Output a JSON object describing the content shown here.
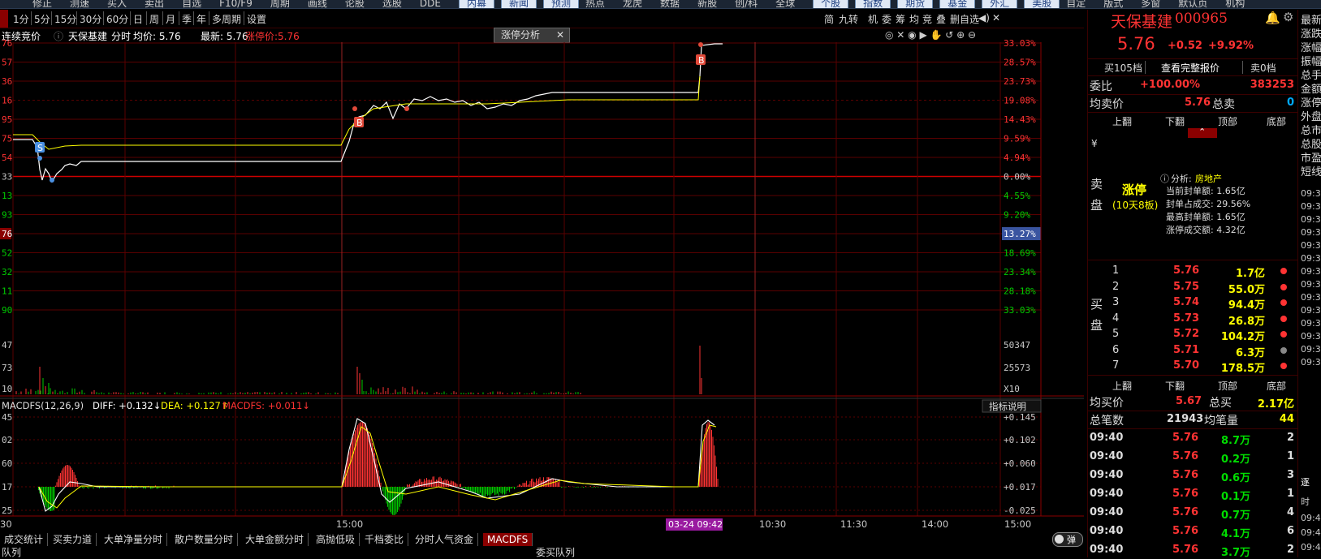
{
  "top_menu": [
    "修正",
    "测速",
    "买入",
    "卖出",
    "自选",
    "F10/F9",
    "周期",
    "画线",
    "论股",
    "选股",
    "DDE",
    "内幕",
    "新闻",
    "预测",
    "热点",
    "龙虎",
    "数据",
    "新股",
    "创/科",
    "全球",
    "个股",
    "指数",
    "期货",
    "基金",
    "外汇",
    "美股",
    "自定",
    "版式",
    "多窗",
    "默认页",
    "机构"
  ],
  "periods": [
    "1分",
    "5分",
    "15分",
    "30分",
    "60分",
    "日",
    "周",
    "月",
    "季",
    "年",
    "多周期",
    "设置"
  ],
  "left_cut_label": "周期",
  "right_toolbar": [
    "简",
    "九转",
    "机",
    "委",
    "筹",
    "均",
    "竞",
    "叠",
    "删自选"
  ],
  "info": {
    "prefix": "连续竞价",
    "name": "天保基建",
    "mode": "分时",
    "avg_label": "均价: 5.76",
    "latest_label": "最新: 5.76",
    "limit_label": "涨停价:5.76",
    "zt_tab": "涨停分析"
  },
  "price_axis_left": [
    "76",
    "57",
    "36",
    "16",
    "95",
    "75",
    "54",
    "33",
    "13",
    "93",
    "76",
    "52",
    "32",
    "11",
    "90"
  ],
  "price_axis_right": [
    "33.03%",
    "28.57%",
    "23.73%",
    "19.08%",
    "14.43%",
    "9.59%",
    "4.94%",
    "0.00%",
    "4.55%",
    "9.20%",
    "13.27%",
    "18.69%",
    "23.34%",
    "28.18%",
    "33.03%"
  ],
  "volume_axis_left": [
    "47",
    "73",
    "10"
  ],
  "volume_axis_right": [
    "50347",
    "25573",
    "X10"
  ],
  "macd": {
    "header": "MACDFS(12,26,9)",
    "diff": "DIFF: +0.132",
    "dea": "DEA: +0.127",
    "macdfs": "MACDFS: +0.011",
    "indicator_btn": "指标说明",
    "left_axis": [
      "45",
      "02",
      "60",
      "17",
      "25"
    ],
    "right_axis": [
      "+0.145",
      "+0.102",
      "+0.060",
      "+0.017",
      "-0.025"
    ]
  },
  "time_axis": {
    "left_cut": "30",
    "labels": [
      "15:00",
      "10:30",
      "11:30",
      "14:00",
      "15:00"
    ],
    "highlight": "03-24 09:42"
  },
  "bottom_tabs": [
    "成交统计",
    "买卖力道",
    "大单净量分时",
    "散户数量分时",
    "大单金额分时",
    "高抛低吸",
    "千档委比",
    "分时人气资金",
    "MACDFS"
  ],
  "bottom_status": {
    "left": "队列",
    "center": "委买队列",
    "toggle": "弹"
  },
  "quote": {
    "name": "天保基建",
    "code": "000965",
    "price": "5.76",
    "change": "+0.52",
    "change_pct": "+9.92%",
    "buttons": [
      "买105档",
      "查看完整报价",
      "卖0档"
    ],
    "weibi_label": "委比",
    "weibi_value": "+100.00%",
    "weibi_num": "383253",
    "avg_sell_label": "均卖价",
    "avg_sell_value": "5.76",
    "total_sell_label": "总卖",
    "total_sell_value": "0",
    "nav": [
      "上翻",
      "下翻",
      "顶部",
      "底部"
    ],
    "sell_side": [
      "卖",
      "盘"
    ],
    "currency": "¥",
    "limit_up_title": "涨停",
    "limit_up_sub": "(10天8板)",
    "analysis_label": "分析:",
    "analysis_value": "房地产",
    "analysis_lines": [
      "当前封单额: 1.65亿",
      "封单占成交: 29.56%",
      "最高封单额: 1.65亿",
      "涨停成交额: 4.32亿"
    ],
    "buy_side": [
      "买",
      "盘"
    ],
    "bids": [
      {
        "lvl": "1",
        "price": "5.76",
        "vol": "1.7亿",
        "dot": "red"
      },
      {
        "lvl": "2",
        "price": "5.75",
        "vol": "55.0万",
        "dot": "red"
      },
      {
        "lvl": "3",
        "price": "5.74",
        "vol": "94.4万",
        "dot": "red"
      },
      {
        "lvl": "4",
        "price": "5.73",
        "vol": "26.8万",
        "dot": "red"
      },
      {
        "lvl": "5",
        "price": "5.72",
        "vol": "104.2万",
        "dot": "red"
      },
      {
        "lvl": "6",
        "price": "5.71",
        "vol": "6.3万",
        "dot": "gray"
      },
      {
        "lvl": "7",
        "price": "5.70",
        "vol": "178.5万",
        "dot": "red"
      }
    ],
    "avg_buy_label": "均买价",
    "avg_buy_value": "5.67",
    "total_buy_label": "总买",
    "total_buy_value": "2.17亿",
    "trades_label": "总笔数",
    "trades_value": "21943",
    "avg_vol_label": "均笔量",
    "avg_vol_value": "44",
    "ticks": [
      {
        "time": "09:40",
        "price": "5.76",
        "vol": "8.7万",
        "n": "2"
      },
      {
        "time": "09:40",
        "price": "5.76",
        "vol": "0.2万",
        "n": "1"
      },
      {
        "time": "09:40",
        "price": "5.76",
        "vol": "0.6万",
        "n": "3"
      },
      {
        "time": "09:40",
        "price": "5.76",
        "vol": "0.1万",
        "n": "1"
      },
      {
        "time": "09:40",
        "price": "5.76",
        "vol": "0.7万",
        "n": "4"
      },
      {
        "time": "09:40",
        "price": "5.76",
        "vol": "4.1万",
        "n": "6"
      },
      {
        "time": "09:40",
        "price": "5.76",
        "vol": "3.7万",
        "n": "2"
      }
    ]
  },
  "far_right": {
    "labels": [
      "最新",
      "涨跌",
      "涨幅",
      "振幅",
      "总手",
      "金额",
      "涨停",
      "外盘",
      "总市",
      "总股",
      "市盈",
      "短线"
    ],
    "times": [
      "09:3",
      "09:3",
      "09:3",
      "09:3",
      "09:3",
      "09:3",
      "09:3",
      "09:3",
      "09:3",
      "09:3",
      "09:3",
      "09:3",
      "09:3",
      "09:3"
    ],
    "bottom": [
      "逐",
      "时",
      "09:4",
      "09:4",
      "09:4"
    ]
  },
  "colors": {
    "up": "#ff3333",
    "down": "#00cc00",
    "yellow": "#ffff00",
    "grid": "#5a0000",
    "bg": "#000000"
  }
}
